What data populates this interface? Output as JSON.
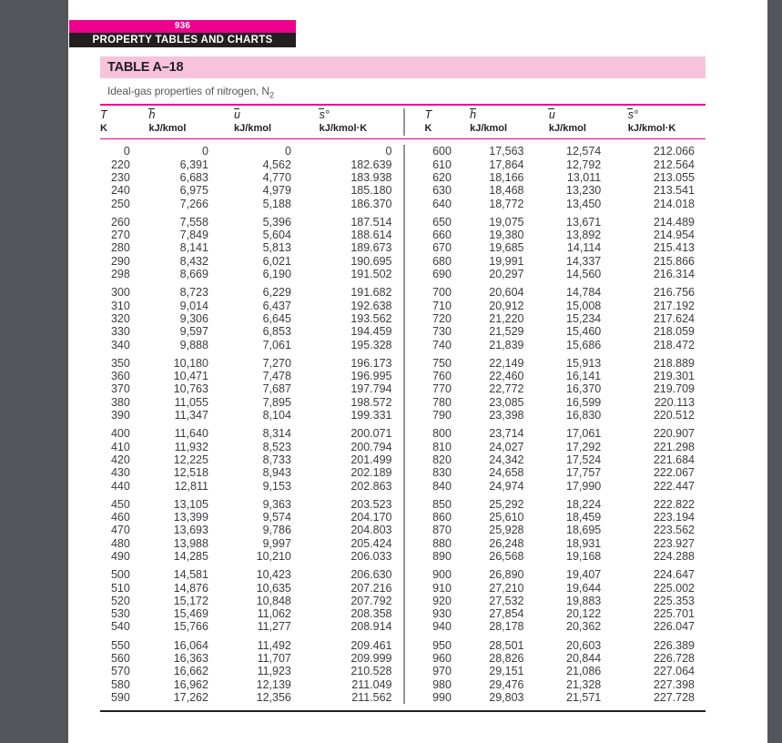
{
  "running_head": {
    "page_number": "936",
    "section_title": "PROPERTY TABLES AND CHARTS"
  },
  "table": {
    "label": "TABLE A–18",
    "subtitle_text": "Ideal-gas properties of nitrogen, N",
    "subtitle_subscript": "2",
    "columns": [
      {
        "symbol": "T",
        "unit": "K",
        "overbar": false,
        "degree": false
      },
      {
        "symbol": "h",
        "unit": "kJ/kmol",
        "overbar": true,
        "degree": false
      },
      {
        "symbol": "u",
        "unit": "kJ/kmol",
        "overbar": true,
        "degree": false
      },
      {
        "symbol": "s",
        "unit": "kJ/kmol·K",
        "overbar": true,
        "degree": true
      }
    ]
  },
  "chart_data": {
    "type": "table",
    "title": "Ideal-gas properties of nitrogen, N2",
    "columns": [
      "T (K)",
      "h-bar (kJ/kmol)",
      "u-bar (kJ/kmol)",
      "s-bar-deg (kJ/kmol·K)"
    ],
    "left_groups": [
      [
        [
          "0",
          "0",
          "0",
          "0"
        ],
        [
          "220",
          "6,391",
          "4,562",
          "182.639"
        ],
        [
          "230",
          "6,683",
          "4,770",
          "183.938"
        ],
        [
          "240",
          "6,975",
          "4,979",
          "185.180"
        ],
        [
          "250",
          "7,266",
          "5,188",
          "186.370"
        ]
      ],
      [
        [
          "260",
          "7,558",
          "5,396",
          "187.514"
        ],
        [
          "270",
          "7,849",
          "5,604",
          "188.614"
        ],
        [
          "280",
          "8,141",
          "5,813",
          "189.673"
        ],
        [
          "290",
          "8,432",
          "6,021",
          "190.695"
        ],
        [
          "298",
          "8,669",
          "6,190",
          "191.502"
        ]
      ],
      [
        [
          "300",
          "8,723",
          "6,229",
          "191.682"
        ],
        [
          "310",
          "9,014",
          "6,437",
          "192.638"
        ],
        [
          "320",
          "9,306",
          "6,645",
          "193.562"
        ],
        [
          "330",
          "9,597",
          "6,853",
          "194.459"
        ],
        [
          "340",
          "9,888",
          "7,061",
          "195.328"
        ]
      ],
      [
        [
          "350",
          "10,180",
          "7,270",
          "196.173"
        ],
        [
          "360",
          "10,471",
          "7,478",
          "196.995"
        ],
        [
          "370",
          "10,763",
          "7,687",
          "197.794"
        ],
        [
          "380",
          "11,055",
          "7,895",
          "198.572"
        ],
        [
          "390",
          "11,347",
          "8,104",
          "199.331"
        ]
      ],
      [
        [
          "400",
          "11,640",
          "8,314",
          "200.071"
        ],
        [
          "410",
          "11,932",
          "8,523",
          "200.794"
        ],
        [
          "420",
          "12,225",
          "8,733",
          "201.499"
        ],
        [
          "430",
          "12,518",
          "8,943",
          "202.189"
        ],
        [
          "440",
          "12,811",
          "9,153",
          "202.863"
        ]
      ],
      [
        [
          "450",
          "13,105",
          "9,363",
          "203.523"
        ],
        [
          "460",
          "13,399",
          "9,574",
          "204.170"
        ],
        [
          "470",
          "13,693",
          "9,786",
          "204.803"
        ],
        [
          "480",
          "13,988",
          "9,997",
          "205.424"
        ],
        [
          "490",
          "14,285",
          "10,210",
          "206.033"
        ]
      ],
      [
        [
          "500",
          "14,581",
          "10,423",
          "206.630"
        ],
        [
          "510",
          "14,876",
          "10,635",
          "207.216"
        ],
        [
          "520",
          "15,172",
          "10,848",
          "207.792"
        ],
        [
          "530",
          "15,469",
          "11,062",
          "208.358"
        ],
        [
          "540",
          "15,766",
          "11,277",
          "208.914"
        ]
      ],
      [
        [
          "550",
          "16,064",
          "11,492",
          "209.461"
        ],
        [
          "560",
          "16,363",
          "11,707",
          "209.999"
        ],
        [
          "570",
          "16,662",
          "11,923",
          "210.528"
        ],
        [
          "580",
          "16,962",
          "12,139",
          "211.049"
        ],
        [
          "590",
          "17,262",
          "12,356",
          "211.562"
        ]
      ]
    ],
    "right_groups": [
      [
        [
          "600",
          "17,563",
          "12,574",
          "212.066"
        ],
        [
          "610",
          "17,864",
          "12,792",
          "212.564"
        ],
        [
          "620",
          "18,166",
          "13,011",
          "213.055"
        ],
        [
          "630",
          "18,468",
          "13,230",
          "213.541"
        ],
        [
          "640",
          "18,772",
          "13,450",
          "214.018"
        ]
      ],
      [
        [
          "650",
          "19,075",
          "13,671",
          "214.489"
        ],
        [
          "660",
          "19,380",
          "13,892",
          "214.954"
        ],
        [
          "670",
          "19,685",
          "14,114",
          "215.413"
        ],
        [
          "680",
          "19,991",
          "14,337",
          "215.866"
        ],
        [
          "690",
          "20,297",
          "14,560",
          "216.314"
        ]
      ],
      [
        [
          "700",
          "20,604",
          "14,784",
          "216.756"
        ],
        [
          "710",
          "20,912",
          "15,008",
          "217.192"
        ],
        [
          "720",
          "21,220",
          "15,234",
          "217.624"
        ],
        [
          "730",
          "21,529",
          "15,460",
          "218.059"
        ],
        [
          "740",
          "21,839",
          "15,686",
          "218.472"
        ]
      ],
      [
        [
          "750",
          "22,149",
          "15,913",
          "218.889"
        ],
        [
          "760",
          "22,460",
          "16,141",
          "219.301"
        ],
        [
          "770",
          "22,772",
          "16,370",
          "219.709"
        ],
        [
          "780",
          "23,085",
          "16,599",
          "220.113"
        ],
        [
          "790",
          "23,398",
          "16,830",
          "220.512"
        ]
      ],
      [
        [
          "800",
          "23,714",
          "17,061",
          "220.907"
        ],
        [
          "810",
          "24,027",
          "17,292",
          "221.298"
        ],
        [
          "820",
          "24,342",
          "17,524",
          "221.684"
        ],
        [
          "830",
          "24,658",
          "17,757",
          "222.067"
        ],
        [
          "840",
          "24,974",
          "17,990",
          "222.447"
        ]
      ],
      [
        [
          "850",
          "25,292",
          "18,224",
          "222.822"
        ],
        [
          "860",
          "25,610",
          "18,459",
          "223.194"
        ],
        [
          "870",
          "25,928",
          "18,695",
          "223.562"
        ],
        [
          "880",
          "26,248",
          "18,931",
          "223.927"
        ],
        [
          "890",
          "26,568",
          "19,168",
          "224.288"
        ]
      ],
      [
        [
          "900",
          "26,890",
          "19,407",
          "224.647"
        ],
        [
          "910",
          "27,210",
          "19,644",
          "225.002"
        ],
        [
          "920",
          "27,532",
          "19,883",
          "225.353"
        ],
        [
          "930",
          "27,854",
          "20,122",
          "225.701"
        ],
        [
          "940",
          "28,178",
          "20,362",
          "226.047"
        ]
      ],
      [
        [
          "950",
          "28,501",
          "20,603",
          "226.389"
        ],
        [
          "960",
          "28,826",
          "20,844",
          "226.728"
        ],
        [
          "970",
          "29,151",
          "21,086",
          "227.064"
        ],
        [
          "980",
          "29,476",
          "21,328",
          "227.398"
        ],
        [
          "990",
          "29,803",
          "21,571",
          "227.728"
        ]
      ]
    ]
  },
  "colors": {
    "accent_magenta": "#ec008c",
    "title_band_pink": "#f7c3dc",
    "header_dark": "#231f20",
    "page_margin_gray": "#53565a"
  }
}
